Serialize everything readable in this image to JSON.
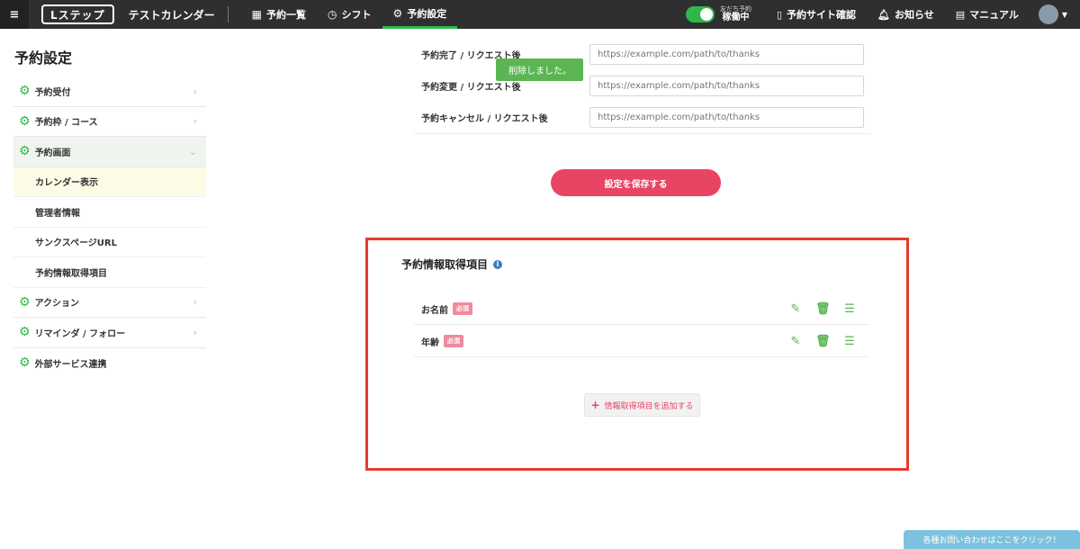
{
  "header": {
    "menu_icon": "≡",
    "logo": "Lステップ",
    "app_name": "テストカレンダー",
    "nav": [
      {
        "label": "予約一覧",
        "icon": "calendar-icon"
      },
      {
        "label": "シフト",
        "icon": "clock-icon"
      },
      {
        "label": "予約設定",
        "icon": "gear-icon",
        "active": true
      }
    ],
    "status_sub": "友だち予約",
    "status_main": "稼働中",
    "site_check": "予約サイト確認",
    "notice": "お知らせ",
    "manual": "マニュアル"
  },
  "sidebar": {
    "title": "予約設定",
    "items": [
      {
        "label": "予約受付"
      },
      {
        "label": "予約枠 / コース"
      },
      {
        "label": "予約画面"
      },
      {
        "label": "アクション"
      },
      {
        "label": "リマインダ / フォロー"
      },
      {
        "label": "外部サービス連携"
      }
    ],
    "subitems": [
      {
        "label": "カレンダー表示"
      },
      {
        "label": "管理者情報"
      },
      {
        "label": "サンクスページURL"
      },
      {
        "label": "予約情報取得項目"
      }
    ]
  },
  "thanks_form": {
    "rows": [
      {
        "label": "予約完了 / リクエスト後",
        "placeholder": "https://example.com/path/to/thanks"
      },
      {
        "label": "予約変更 / リクエスト後",
        "placeholder": "https://example.com/path/to/thanks"
      },
      {
        "label": "予約キャンセル / リクエスト後",
        "placeholder": "https://example.com/path/to/thanks"
      }
    ]
  },
  "toast": "削除しました。",
  "save_button": "設定を保存する",
  "info_section": {
    "title": "予約情報取得項目",
    "fields": [
      {
        "name": "お名前",
        "badge": "必須"
      },
      {
        "name": "年齢",
        "badge": "必須"
      }
    ],
    "add_button": "情報取得項目を追加する"
  },
  "help_button": "各種お問い合わせはここをクリック！",
  "colors": {
    "accent_green": "#2eb84b",
    "save_pink": "#e84565",
    "highlight_red": "#e53b2b"
  }
}
